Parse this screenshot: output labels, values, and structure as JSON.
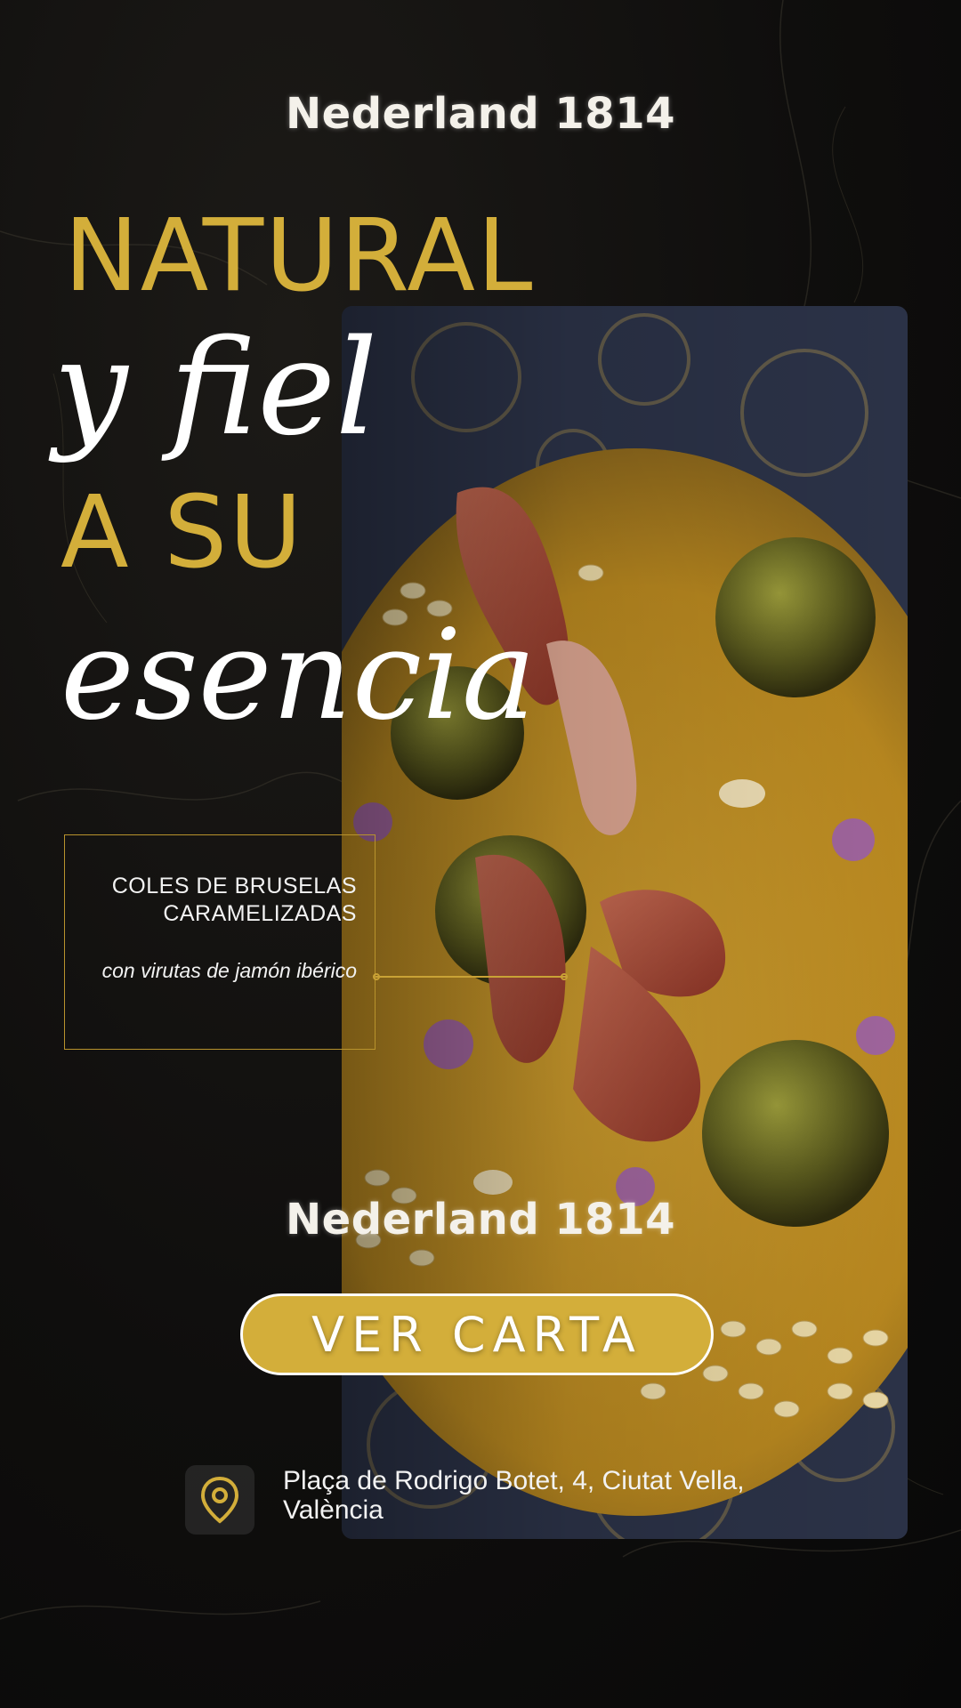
{
  "brand": {
    "name_top": "Nederland 1814",
    "name_bottom": "Nederland 1814"
  },
  "headline": {
    "line1": "NATURAL",
    "line2": "y fiel",
    "line3": "A SU",
    "line4": "esencia"
  },
  "dish": {
    "title": "COLES DE BRUSELAS CARAMELIZADAS",
    "subtitle": "con virutas de jamón ibérico"
  },
  "cta": {
    "label": "VER CARTA"
  },
  "location": {
    "icon": "map-pin-icon",
    "address": "Plaça de Rodrigo Botet, 4, Ciutat Vella, València"
  },
  "colors": {
    "background": "#0f0e0d",
    "gold": "#d3ae3a",
    "text": "#ffffff"
  }
}
